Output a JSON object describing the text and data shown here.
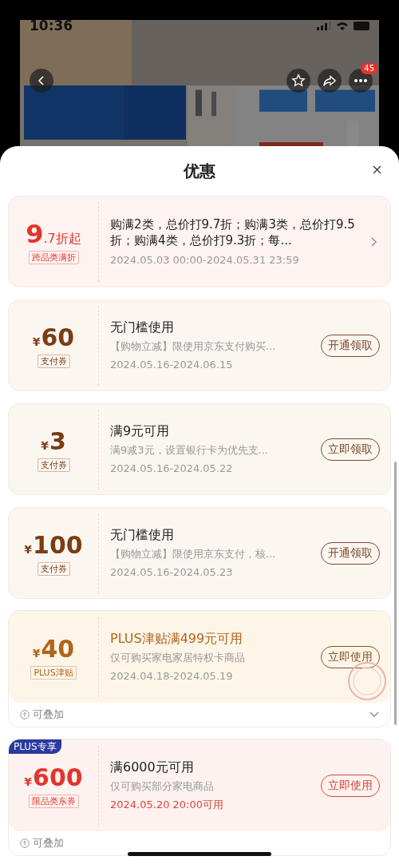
{
  "status_bar": {
    "time": "10:36"
  },
  "top_bar": {
    "more_badge": "45"
  },
  "sheet": {
    "title": "优惠"
  },
  "offers": [
    {
      "kind": "discount",
      "amount": "9",
      "amount_suffix": ".7折起",
      "tag": "跨品类满折",
      "title": "购满2类，总价打9.7折；购满3类，总价打9.5折；购满4类，总价打9.3折；每...",
      "date": "2024.05.03 00:00-2024.05.31 23:59"
    },
    {
      "kind": "pay",
      "currency": "¥",
      "amount": "60",
      "tag": "支付券",
      "title": "无门槛使用",
      "desc": "【购物立减】限使用京东支付购买...",
      "date": "2024.05.16-2024.06.15",
      "button": "开通领取"
    },
    {
      "kind": "pay",
      "currency": "¥",
      "amount": "3",
      "tag": "支付券",
      "title": "满9元可用",
      "desc": "满9减3元，设置银行卡为优先支...",
      "date": "2024.05.16-2024.05.22",
      "button": "立即领取"
    },
    {
      "kind": "pay",
      "currency": "¥",
      "amount": "100",
      "tag": "支付券",
      "title": "无门槛使用",
      "desc": "【购物立减】限使用京东支付，核...",
      "date": "2024.05.16-2024.05.23",
      "button": "开通领取"
    },
    {
      "kind": "plus",
      "currency": "¥",
      "amount": "40",
      "tag": "PLUS津贴",
      "title": "PLUS津贴满499元可用",
      "desc": "仅可购买家电家居特权卡商品",
      "date": "2024.04.18-2024.05.19",
      "button": "立即使用",
      "stamp": true,
      "footer": {
        "label": "可叠加",
        "expanded": false
      }
    },
    {
      "kind": "category",
      "corner_badge": "PLUS专享",
      "currency": "¥",
      "amount": "600",
      "tag": "限品类东券",
      "title": "满6000元可用",
      "desc": "仅可购买部分家电商品",
      "date": "2024.05.20 20:00可用",
      "button": "立即使用",
      "footer": {
        "label": "可叠加"
      }
    }
  ]
}
